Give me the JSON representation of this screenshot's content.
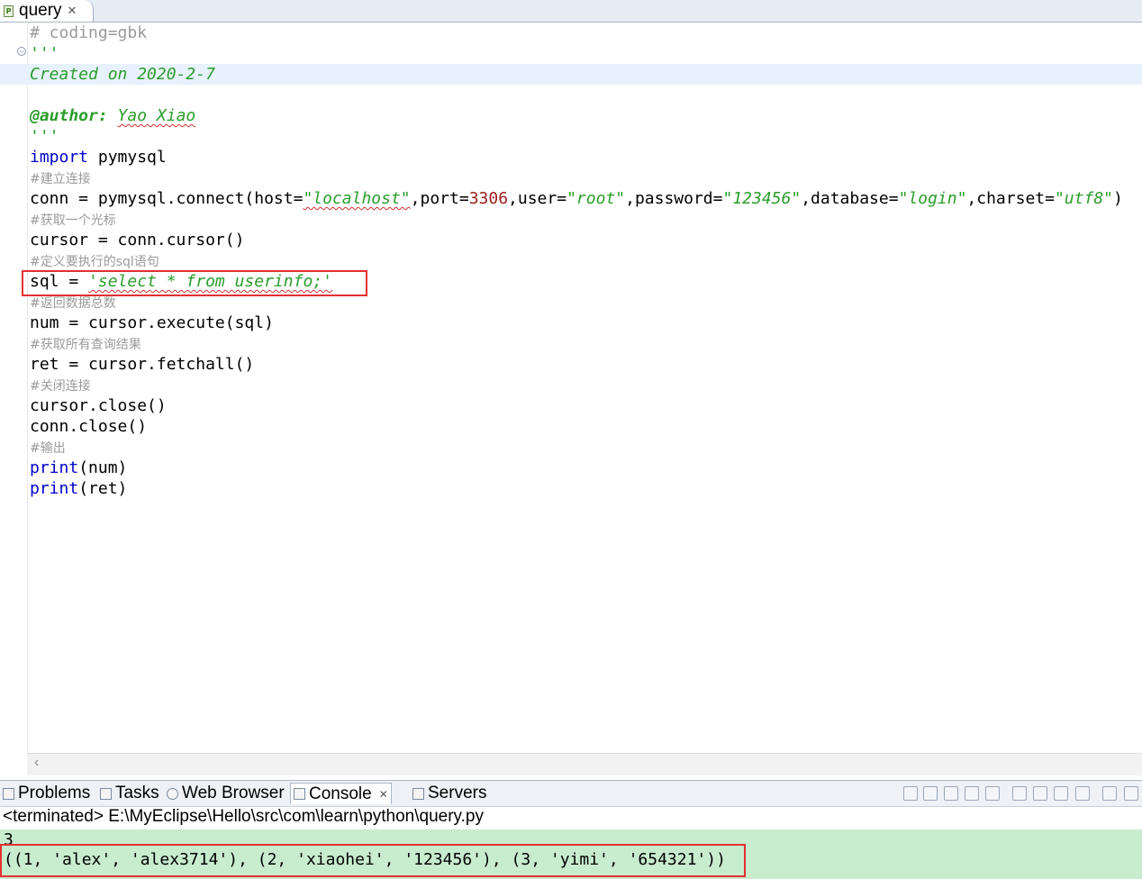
{
  "editor_tab": {
    "label": "query",
    "icon": "python-file-icon",
    "close": "✕"
  },
  "code": {
    "l1": "# coding=gbk",
    "l2": "'''",
    "l3": "Created on 2020-2-7",
    "l5_tag": "@author:",
    "l5_name": "Yao Xiao",
    "l6": "'''",
    "l7_kw": "import",
    "l7_rest": " pymysql",
    "c1": "#建立连接",
    "l9": {
      "a": "conn = pymysql.connect(host=",
      "host": "\"localhost\"",
      "b": ",port=",
      "port": "3306",
      "c": ",user=",
      "user": "\"root\"",
      "d": ",password=",
      "password": "\"123456\"",
      "e": ",database=",
      "database": "\"login\"",
      "f": ",charset=",
      "charset": "\"utf8\"",
      "g": ")"
    },
    "c2": "#获取一个光标",
    "l11": "cursor = conn.cursor()",
    "c3": "#定义要执行的sql语句",
    "l13_a": "sql = ",
    "l13_str": "'select * from userinfo;'",
    "c4": "#返回数据总数",
    "l15": "num = cursor.execute(sql)",
    "c5": "#获取所有查询结果",
    "l17": "ret = cursor.fetchall()",
    "c6": "#关闭连接",
    "l19": "cursor.close()",
    "l20": "conn.close()",
    "c7": "#输出",
    "l22_kw": "print",
    "l22_rest": "(num)",
    "l23_kw": "print",
    "l23_rest": "(ret)"
  },
  "panel_tabs": [
    {
      "label": "Problems",
      "icon": "problems-icon"
    },
    {
      "label": "Tasks",
      "icon": "tasks-icon"
    },
    {
      "label": "Web Browser",
      "icon": "globe-icon"
    },
    {
      "label": "Console",
      "icon": "console-icon",
      "active": true,
      "close": "✕"
    },
    {
      "label": "Servers",
      "icon": "servers-icon"
    }
  ],
  "console": {
    "path": "<terminated> E:\\MyEclipse\\Hello\\src\\com\\learn\\python\\query.py",
    "out1": "3",
    "out2": "((1, 'alex', 'alex3714'), (2, 'xiaohei', '123456'), (3, 'yimi', '654321'))"
  },
  "colors": {
    "keyword": "#0000c8",
    "string": "#2a9d2a",
    "comment": "#9a9a9a",
    "number": "#9b1b1b",
    "console_bg": "#c7ecce",
    "annotation_box": "#e53030"
  }
}
